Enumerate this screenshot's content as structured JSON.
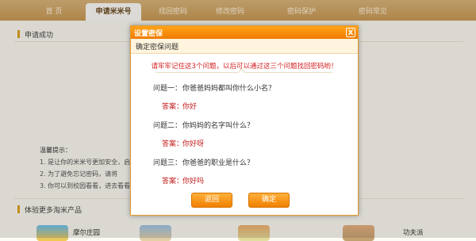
{
  "nav": {
    "tabs": [
      {
        "label": "首 页"
      },
      {
        "label": "申请米米号"
      },
      {
        "label": "找回密码"
      },
      {
        "label": "修改密码"
      },
      {
        "label": "密码保护"
      },
      {
        "label": "密码常见"
      }
    ]
  },
  "background": {
    "success_title": "申请成功",
    "notice_title": "温馨提示：",
    "notice_items": [
      "1. 是让你的米米号更加安全，启",
      "2. 为了避免忘记密码，请将",
      "3. 你可以到校园看看，进去看看"
    ],
    "products_title": "体验更多淘米产品",
    "products": [
      {
        "name": "摩尔庄园"
      },
      {
        "name": "功夫派"
      }
    ]
  },
  "dialog": {
    "title": "设置密保",
    "close": "X",
    "subtitle": "确定密保问题",
    "warning": "请牢牢记住这3个问题，以后可以通过这三个问题找回密码哟！",
    "questions": [
      {
        "label": "问题一：",
        "question": "你爸爸妈妈都叫你什么小名？",
        "answer_label": "答案：",
        "answer": "你好"
      },
      {
        "label": "问题二：",
        "question": "你妈妈的名字叫什么？",
        "answer_label": "答案：",
        "answer": "你好呀"
      },
      {
        "label": "问题三：",
        "question": "你爸爸的职业是什么？",
        "answer_label": "答案：",
        "answer": "你好吗"
      }
    ],
    "back_button": "返回",
    "confirm_button": "确定"
  },
  "colors": {
    "accent": "#f08000",
    "answer": "#c32020"
  }
}
